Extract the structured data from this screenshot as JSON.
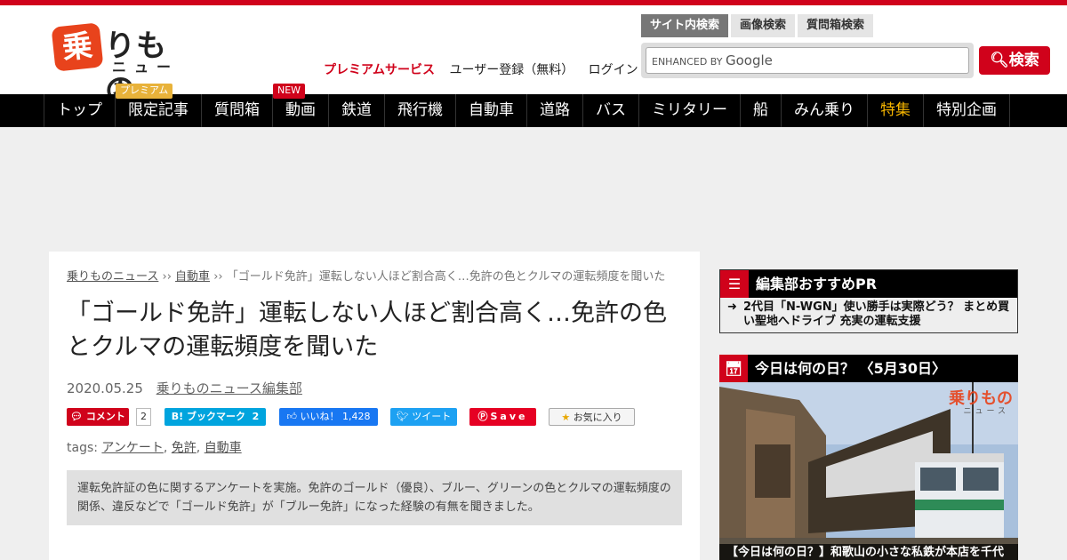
{
  "logo": {
    "mark": "乗",
    "text": "りもの",
    "sub": "ニュース"
  },
  "utility": {
    "premium": "プレミアムサービス",
    "register": "ユーザー登録（無料）",
    "login": "ログイン"
  },
  "search": {
    "tabs": [
      "サイト内検索",
      "画像検索",
      "質問箱検索"
    ],
    "placeholder_prefix": "ENHANCED BY",
    "placeholder_brand": "Google",
    "button_label": "検索"
  },
  "nav": {
    "items": [
      "トップ",
      "限定記事",
      "質問箱",
      "動画",
      "鉄道",
      "飛行機",
      "自動車",
      "道路",
      "バス",
      "ミリタリー",
      "船",
      "みん乗り",
      "特集",
      "特別企画"
    ],
    "badge_premium": "プレミアム",
    "badge_new": "NEW"
  },
  "article": {
    "breadcrumb": {
      "home": "乗りものニュース",
      "sep": "››",
      "category": "自動車",
      "current": "「ゴールド免許」運転しない人ほど割合高く…免許の色とクルマの運転頻度を聞いた"
    },
    "title": "「ゴールド免許」運転しない人ほど割合高く…免許の色とクルマの運転頻度を聞いた",
    "date": "2020.05.25",
    "author": "乗りものニュース編集部",
    "share": {
      "comment_label": "コメント",
      "comment_count": "2",
      "hatena_label": "B! ブックマーク",
      "hatena_count": "2",
      "fb_label": "いいね！",
      "fb_count": "1,428",
      "tweet_label": "ツイート",
      "pin_label": "Save",
      "fav_label": "お気に入り"
    },
    "tags_label": "tags:",
    "tags": [
      "アンケート",
      "免許",
      "自動車"
    ],
    "summary": "運転免許証の色に関するアンケートを実施。免許のゴールド（優良）、ブルー、グリーンの色とクルマの運転頻度の関係、違反などで「ゴールド免許」が「ブルー免許」になった経験の有無を聞きました。"
  },
  "sidebar": {
    "pr_title": "編集部おすすめPR",
    "pr_item": "2代目「N-WGN」使い勝手は実際どう？ まとめ買い聖地へドライブ 充実の運転支援",
    "today_title": "今日は何の日？ 〈5月30日〉",
    "photo_logo": "乗りもの",
    "photo_logo_sub": "ニュース",
    "photo_caption": "【今日は何の日？】和歌山の小さな私鉄が本店を千代"
  },
  "colors": {
    "brand": "#d0021b",
    "nav_bg": "#000000",
    "special": "#f5b400"
  }
}
